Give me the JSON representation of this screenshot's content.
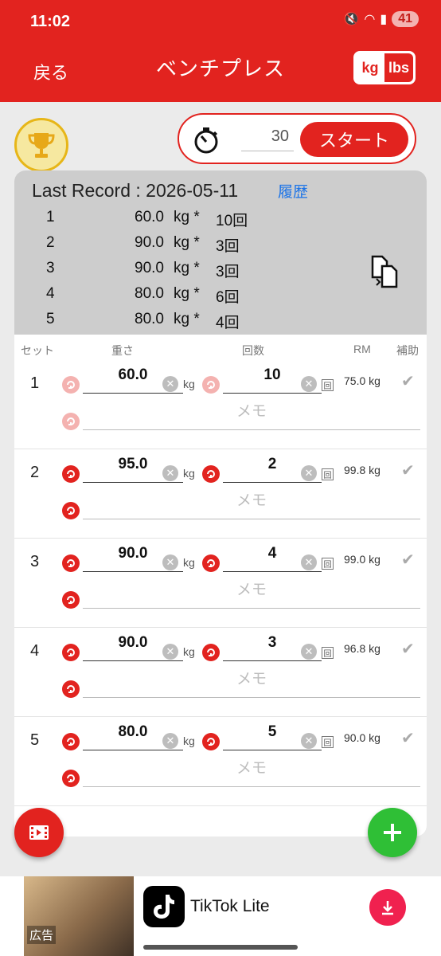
{
  "status_bar": {
    "time": "11:02",
    "battery": "41"
  },
  "header": {
    "back_label": "戻る",
    "title": "ベンチプレス",
    "unit_kg": "kg",
    "unit_lbs": "lbs"
  },
  "timer": {
    "value": "30",
    "start_label": "スタート"
  },
  "last_record": {
    "title": "Last Record : 2026-05-11",
    "history_label": "履歴",
    "unit": "kg *",
    "rows": [
      {
        "n": "1",
        "weight": "60.0",
        "reps": "10回"
      },
      {
        "n": "2",
        "weight": "90.0",
        "reps": "3回"
      },
      {
        "n": "3",
        "weight": "90.0",
        "reps": "3回"
      },
      {
        "n": "4",
        "weight": "80.0",
        "reps": "6回"
      },
      {
        "n": "5",
        "weight": "80.0",
        "reps": "4回"
      }
    ]
  },
  "columns": {
    "set": "セット",
    "weight": "重さ",
    "reps": "回数",
    "rm": "RM",
    "assist": "補助"
  },
  "sets": [
    {
      "n": "1",
      "weight": "60.0",
      "weight_unit": "kg",
      "reps": "10",
      "reps_unit": "回",
      "rm": "75.0 kg",
      "memo_placeholder": "メモ"
    },
    {
      "n": "2",
      "weight": "95.0",
      "weight_unit": "kg",
      "reps": "2",
      "reps_unit": "回",
      "rm": "99.8 kg",
      "memo_placeholder": "メモ"
    },
    {
      "n": "3",
      "weight": "90.0",
      "weight_unit": "kg",
      "reps": "4",
      "reps_unit": "回",
      "rm": "99.0 kg",
      "memo_placeholder": "メモ"
    },
    {
      "n": "4",
      "weight": "90.0",
      "weight_unit": "kg",
      "reps": "3",
      "reps_unit": "回",
      "rm": "96.8 kg",
      "memo_placeholder": "メモ"
    },
    {
      "n": "5",
      "weight": "80.0",
      "weight_unit": "kg",
      "reps": "5",
      "reps_unit": "回",
      "rm": "90.0 kg",
      "memo_placeholder": "メモ"
    }
  ],
  "ad": {
    "label": "広告",
    "app_name": "TikTok Lite"
  },
  "colors": {
    "accent": "#e2231f",
    "add": "#2fbf36",
    "link": "#1a73e8"
  },
  "icons": [
    "trophy-icon",
    "stopwatch-icon",
    "copy-icon",
    "redo-icon",
    "clear-icon",
    "check-icon",
    "video-icon",
    "plus-icon",
    "download-icon"
  ]
}
